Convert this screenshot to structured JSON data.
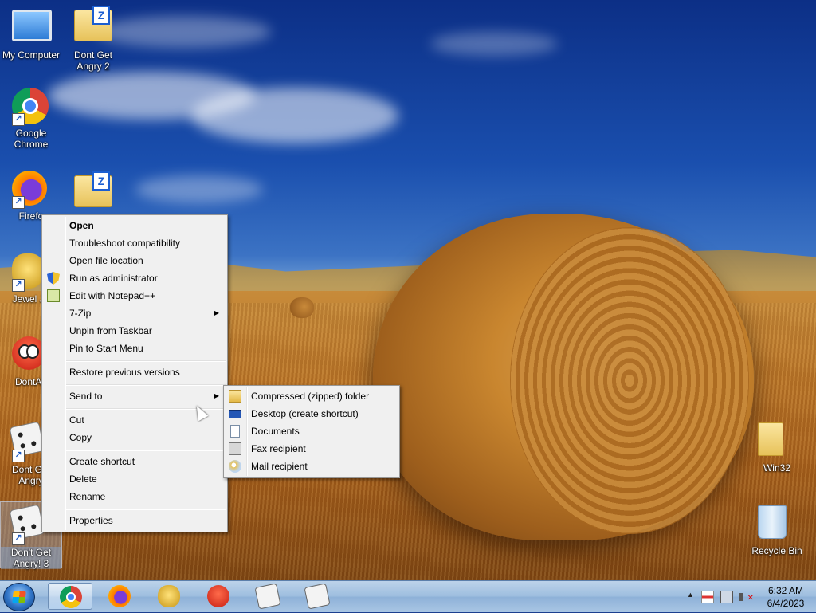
{
  "desktop": {
    "icons": [
      {
        "label": "My Computer"
      },
      {
        "label": "Dont Get Angry 2"
      },
      {
        "label": "Google Chrome"
      },
      {
        "label": "Firefo"
      },
      {
        "label": "Jewel Jo"
      },
      {
        "label": "DontAn"
      },
      {
        "label": "Dont Get Angry"
      },
      {
        "label": "Don't Get Angry! 3"
      },
      {
        "label": "Win32"
      },
      {
        "label": "Recycle Bin"
      }
    ]
  },
  "context_menu": {
    "items": [
      {
        "label": "Open"
      },
      {
        "label": "Troubleshoot compatibility"
      },
      {
        "label": "Open file location"
      },
      {
        "label": "Run as administrator",
        "icon": "uac-shield-icon"
      },
      {
        "label": "Edit with Notepad++",
        "icon": "notepadpp-icon"
      },
      {
        "label": "7-Zip"
      },
      {
        "label": "Unpin from Taskbar"
      },
      {
        "label": "Pin to Start Menu"
      },
      {
        "label": "Restore previous versions"
      },
      {
        "label": "Send to"
      },
      {
        "label": "Cut"
      },
      {
        "label": "Copy"
      },
      {
        "label": "Create shortcut"
      },
      {
        "label": "Delete"
      },
      {
        "label": "Rename"
      },
      {
        "label": "Properties"
      }
    ]
  },
  "send_to_menu": {
    "items": [
      {
        "label": "Compressed (zipped) folder",
        "icon": "zip-folder-icon"
      },
      {
        "label": "Desktop (create shortcut)",
        "icon": "desktop-icon"
      },
      {
        "label": "Documents",
        "icon": "documents-icon"
      },
      {
        "label": "Fax recipient",
        "icon": "fax-icon"
      },
      {
        "label": "Mail recipient",
        "icon": "mail-icon"
      }
    ]
  },
  "taskbar": {
    "time": "6:32 AM",
    "date": "6/4/2023",
    "pinned": [
      "chrome-icon",
      "firefox-icon",
      "jewel-icon",
      "angry-bird-icon",
      "dice-icon",
      "dice-icon"
    ]
  }
}
